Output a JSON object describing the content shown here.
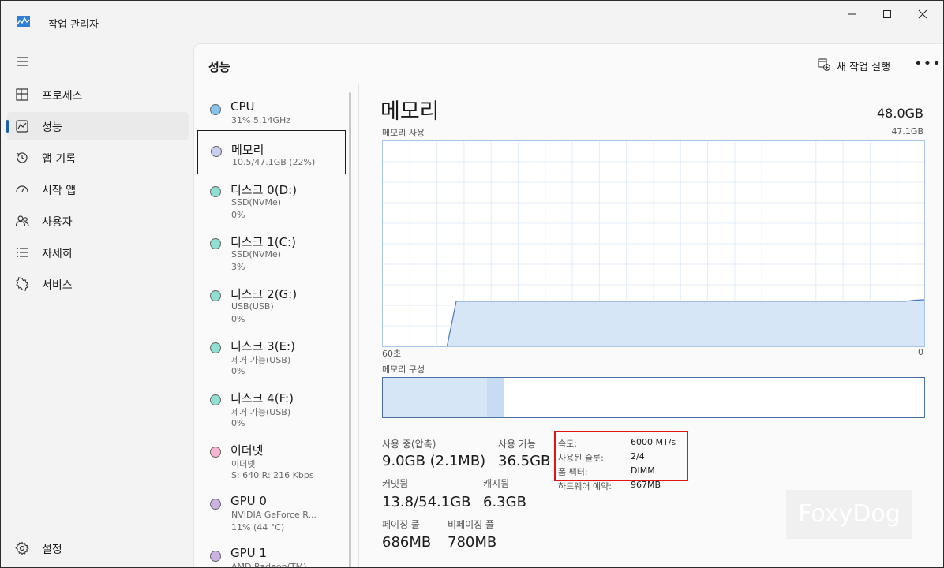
{
  "window": {
    "title": "작업 관리자"
  },
  "nav": {
    "items": [
      {
        "label": "프로세스",
        "icon": "processes-icon"
      },
      {
        "label": "성능",
        "icon": "performance-icon",
        "active": true
      },
      {
        "label": "앱 기록",
        "icon": "app-history-icon"
      },
      {
        "label": "시작 앱",
        "icon": "startup-apps-icon"
      },
      {
        "label": "사용자",
        "icon": "users-icon"
      },
      {
        "label": "자세히",
        "icon": "details-icon"
      },
      {
        "label": "서비스",
        "icon": "services-icon"
      }
    ],
    "settings_label": "설정"
  },
  "header": {
    "title": "성능",
    "run_task_label": "새 작업 실행",
    "more_label": "•••"
  },
  "perf_list": [
    {
      "name": "CPU",
      "sub": "31% 5.14GHz",
      "sub2": "",
      "color": "#86c3ee"
    },
    {
      "name": "메모리",
      "sub": "10.5/47.1GB (22%)",
      "sub2": "",
      "color": "#c9cdf2",
      "selected": true
    },
    {
      "name": "디스크 0(D:)",
      "sub": "SSD(NVMe)",
      "sub2": "0%",
      "color": "#8fdfd3"
    },
    {
      "name": "디스크 1(C:)",
      "sub": "SSD(NVMe)",
      "sub2": "3%",
      "color": "#8fdfd3"
    },
    {
      "name": "디스크 2(G:)",
      "sub": "USB(USB)",
      "sub2": "0%",
      "color": "#8fdfd3"
    },
    {
      "name": "디스크 3(E:)",
      "sub": "제거 가능(USB)",
      "sub2": "0%",
      "color": "#8fdfd3"
    },
    {
      "name": "디스크 4(F:)",
      "sub": "제거 가능(USB)",
      "sub2": "0%",
      "color": "#8fdfd3"
    },
    {
      "name": "이더넷",
      "sub": "이더넷",
      "sub2": "S: 640 R: 216 Kbps",
      "color": "#f7b6d2"
    },
    {
      "name": "GPU 0",
      "sub": "NVIDIA GeForce R...",
      "sub2": "11% (44 °C)",
      "color": "#cbb2e4"
    },
    {
      "name": "GPU 1",
      "sub": "AMD Radeon(TM)...",
      "sub2": "",
      "color": "#cbb2e4"
    }
  ],
  "memory": {
    "title": "메모리",
    "total": "48.0GB",
    "usage_label": "메모리 사용",
    "usage_max": "47.1GB",
    "time_left": "60초",
    "time_right": "0",
    "composition_label": "메모리 구성",
    "usage_history_fraction": [
      0,
      0,
      0,
      0,
      0,
      0,
      0,
      0,
      0.22,
      0.22,
      0.22,
      0.22,
      0.22,
      0.22,
      0.22,
      0.22,
      0.22,
      0.22,
      0.22,
      0.22,
      0.22,
      0.22,
      0.22,
      0.22,
      0.22,
      0.22,
      0.22,
      0.22,
      0.22,
      0.22,
      0.22,
      0.22,
      0.22,
      0.22,
      0.22,
      0.22,
      0.22,
      0.22,
      0.22,
      0.22,
      0.22,
      0.22,
      0.22,
      0.22,
      0.22,
      0.22,
      0.22,
      0.22,
      0.22,
      0.22,
      0.22,
      0.22,
      0.22,
      0.22,
      0.22,
      0.22,
      0.22,
      0.22,
      0.225,
      0.227
    ],
    "composition_fractions": [
      0.192,
      0.033,
      0.101,
      0.674
    ],
    "stats": {
      "in_use_label": "사용 중(압축)",
      "in_use_value": "9.0GB (2.1MB)",
      "available_label": "사용 가능",
      "available_value": "36.5GB",
      "committed_label": "커밋됨",
      "committed_value": "13.8/54.1GB",
      "cached_label": "캐시됨",
      "cached_value": "6.3GB",
      "paged_label": "페이징 풀",
      "paged_value": "686MB",
      "nonpaged_label": "비페이징 풀",
      "nonpaged_value": "780MB"
    },
    "specs": {
      "speed_label": "속도:",
      "speed_value": "6000 MT/s",
      "slots_label": "사용된 슬롯:",
      "slots_value": "2/4",
      "form_label": "폼 팩터:",
      "form_value": "DIMM",
      "reserved_label": "하드웨어 예약:",
      "reserved_value": "967MB"
    }
  },
  "watermark": "FoxyDog",
  "colors": {
    "accent": "#1f5fa8",
    "graph_line": "#4a7ab8",
    "graph_fill": "#d6e6f7",
    "highlight": "#e01515"
  }
}
